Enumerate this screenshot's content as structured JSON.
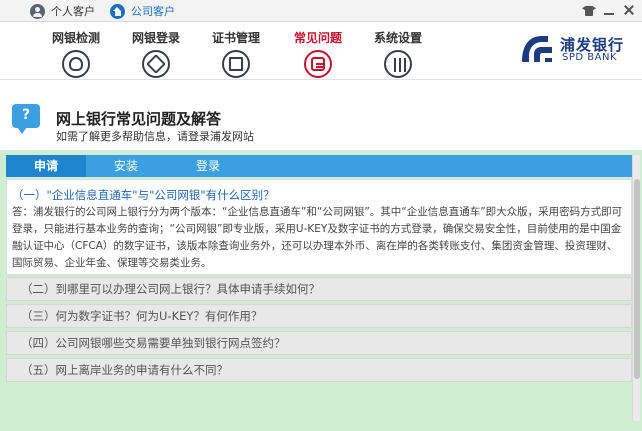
{
  "topbar": {
    "personal_label": "个人客户",
    "corporate_label": "公司客户"
  },
  "nav": {
    "items": [
      {
        "label": "网银检测",
        "icon": "detect-icon"
      },
      {
        "label": "网银登录",
        "icon": "login-icon"
      },
      {
        "label": "证书管理",
        "icon": "certificate-icon"
      },
      {
        "label": "常见问题",
        "icon": "faq-icon",
        "active": true
      },
      {
        "label": "系统设置",
        "icon": "settings-icon"
      }
    ],
    "active_color": "#c8102e"
  },
  "brand": {
    "name_cn": "浦发银行",
    "name_en": "SPD BANK",
    "color": "#1d3c80"
  },
  "heading": {
    "title": "网上银行常见问题及解答",
    "subtitle": "如需了解更多帮助信息，请登录浦发网站"
  },
  "tabs": [
    {
      "label": "申请",
      "active": true
    },
    {
      "label": "安装"
    },
    {
      "label": "登录"
    }
  ],
  "faq": {
    "open_question": "（一）\"企业信息直通车\"与\"公司网银\"有什么区别？",
    "open_answer": "答：浦发银行的公司网上银行分为两个版本：“企业信息直通车”和“公司网银”。其中“企业信息直通车”即大众版，采用密码方式即可登录，只能进行基本业务的查询；“公司网银”即专业版，采用U-KEY及数字证书的方式登录，确保交易安全性，目前使用的是中国金融认证中心（CFCA）的数字证书，该版本除查询业务外，还可以办理本外币、离在岸的各类转账支付、集团资金管理、投资理财、国际贸易、企业年金、保理等交易类业务。",
    "collapsed": [
      "（二）到哪里可以办理公司网上银行？具体申请手续如何？",
      "（三）何为数字证书？何为U-KEY？有何作用？",
      "（四）公司网银哪些交易需要单独到银行网点签约？",
      "（五）网上离岸业务的申请有什么不同？"
    ]
  },
  "colors": {
    "tab_bar": "#3aa0e2",
    "panel_bg": "#cfedd0",
    "question_link": "#2367b4"
  }
}
